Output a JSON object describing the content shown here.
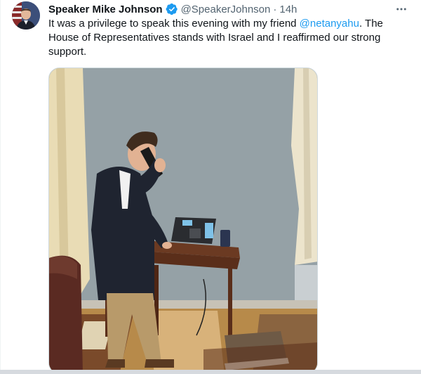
{
  "tweet": {
    "author": {
      "display_name": "Speaker Mike Johnson",
      "handle": "@SpeakerJohnson",
      "verified": true,
      "avatar_icon": "avatar-photo"
    },
    "separator": "·",
    "timestamp": "14h",
    "more_icon": "more-horizontal-icon",
    "text": {
      "before": "It was a privilege to speak this evening with my friend ",
      "mention": "@netanyahu",
      "after": ". The House of Representatives stands with Israel and I reaffirmed our strong support."
    },
    "media": {
      "kind": "photo"
    }
  },
  "colors": {
    "text": "#0f1419",
    "secondary": "#536471",
    "link": "#1d9bf0",
    "verified": "#1d9bf0"
  }
}
